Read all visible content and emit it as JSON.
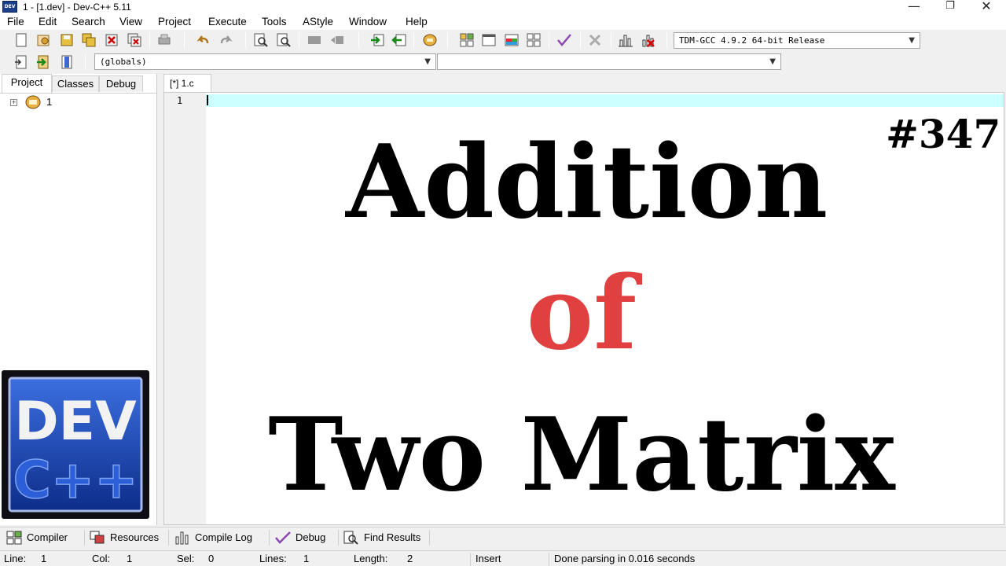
{
  "window": {
    "title": "1 - [1.dev] - Dev-C++ 5.11",
    "icon_label": "DEV",
    "minimize_glyph": "—",
    "maximize_glyph": "❐",
    "close_glyph": "✕"
  },
  "menu": [
    "File",
    "Edit",
    "Search",
    "View",
    "Project",
    "Execute",
    "Tools",
    "AStyle",
    "Window",
    "Help"
  ],
  "toolbar": {
    "icons": [
      "new-file-icon",
      "open-project-icon",
      "save-icon",
      "save-all-icon",
      "close-icon",
      "close-all-icon",
      "print-icon",
      "undo-icon",
      "redo-icon",
      "find-icon",
      "replace-icon",
      "indent-icon",
      "unindent-icon",
      "goto-icon",
      "bookmark-icon",
      "new-project-icon",
      "window-icon",
      "view-icon",
      "grid-icon",
      "check-icon",
      "stop-icon",
      "chart-icon",
      "profile-icon"
    ],
    "compiler_select": "TDM-GCC 4.9.2 64-bit Release",
    "globals_select": "(globals)",
    "member_select": ""
  },
  "left_panel": {
    "tabs": [
      "Project",
      "Classes",
      "Debug"
    ],
    "tree_item": "1",
    "logo": {
      "top": "DEV",
      "bottom": "C++"
    }
  },
  "editor": {
    "tab_label": "[*] 1.c",
    "line_number": "1"
  },
  "overlay": {
    "number": "#347",
    "line1": "Addition",
    "line2": "of",
    "line3": "Two Matrix",
    "accent_color": "#e0403f"
  },
  "bottom_tabs": [
    "Compiler",
    "Resources",
    "Compile Log",
    "Debug",
    "Find Results"
  ],
  "status": {
    "line_label": "Line:",
    "line_value": "1",
    "col_label": "Col:",
    "col_value": "1",
    "sel_label": "Sel:",
    "sel_value": "0",
    "lines_label": "Lines:",
    "lines_value": "1",
    "length_label": "Length:",
    "length_value": "2",
    "mode": "Insert",
    "message": "Done parsing in 0.016 seconds"
  }
}
